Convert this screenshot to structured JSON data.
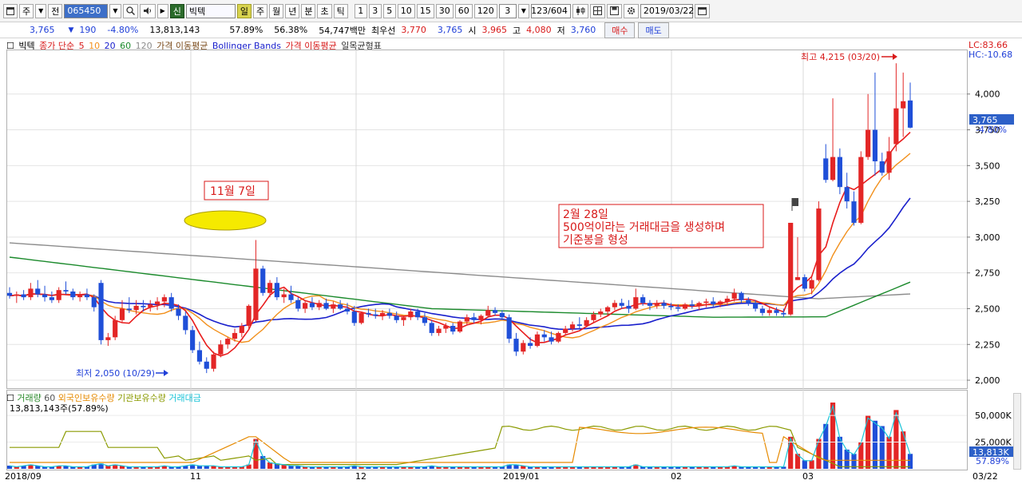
{
  "toolbar": {
    "period_prefix": "주",
    "jeon_label": "전",
    "stock_code": "065450",
    "stock_name": "빅텍",
    "credit_badge": "신",
    "periods": [
      "일",
      "주",
      "월",
      "년",
      "분",
      "초",
      "틱"
    ],
    "active_period": "일",
    "minutes": [
      "1",
      "3",
      "5",
      "10",
      "15",
      "30",
      "60",
      "120"
    ],
    "select_value": "3",
    "page_counter": "123/604",
    "date": "2019/03/22"
  },
  "quote": {
    "price": "3,765",
    "change_arrow": "▼",
    "change": "190",
    "change_pct": "-4.80%",
    "volume": "13,813,143",
    "volume_ratio": "57.89%",
    "ratio2": "56.38%",
    "amount": "54,747백만",
    "best_ask_label": "최우선",
    "best_ask": "3,770",
    "best_bid": "3,765",
    "open_label": "시",
    "open": "3,965",
    "high_label": "고",
    "high": "4,080",
    "low_label": "저",
    "low": "3,760",
    "buy_btn": "매수",
    "sell_btn": "매도"
  },
  "legend": {
    "name": "빅텍",
    "ma_label": "종가 단순",
    "ma5": "5",
    "ma10": "10",
    "ma20": "20",
    "ma60": "60",
    "ma120": "120",
    "price_ma": "가격 이동평균",
    "bollinger": "Bollinger Bands",
    "price_ma2": "가격 이동평균",
    "ichimoku": "일목균형표"
  },
  "right_info": {
    "lc": "LC:83.66",
    "hc": "HC:-10.68"
  },
  "annotations": {
    "high_note": "최고 4,215 (03/20)",
    "low_note": "최저 2,050 (10/29)",
    "nov_label": "11월 7일",
    "feb_line1": "2월 28일",
    "feb_line2": "500억이라는 거래대금을 생성하며",
    "feb_line3": "기준봉을 형성"
  },
  "price_axis": {
    "ticks": [
      "4,000",
      "3,750",
      "3,500",
      "3,250",
      "3,000",
      "2,750",
      "2,500",
      "2,250",
      "2,000"
    ],
    "current_price": "3,765",
    "current_pct": "-4.80%"
  },
  "volume_panel": {
    "legend_vol": "거래량",
    "legend_vol_ma": "60",
    "legend_foreign": "외국인보유수량",
    "legend_inst": "기관보유수량",
    "legend_amount": "거래대금",
    "summary": "13,813,143주(57.89%)",
    "ticks": [
      "50,000K",
      "25,000K"
    ],
    "current": "13,813K",
    "current_pct": "57.89%"
  },
  "x_axis": [
    "2018/09",
    "11",
    "12",
    "2019/01",
    "02",
    "03",
    "03/22"
  ],
  "colors": {
    "up": "#e32626",
    "down": "#1f4fd8",
    "ma5": "#e81c1c",
    "ma20": "#f2901c",
    "ma60": "#1a20cc",
    "ma120": "#1b8a2c",
    "ma_long": "#8c8c8c"
  },
  "chart_data": {
    "type": "candlestick",
    "ylim": [
      1950,
      4300
    ],
    "candles": [
      [
        2610,
        2650,
        2570,
        2590
      ],
      [
        2590,
        2620,
        2540,
        2600
      ],
      [
        2600,
        2630,
        2560,
        2580
      ],
      [
        2580,
        2680,
        2560,
        2640
      ],
      [
        2640,
        2700,
        2580,
        2600
      ],
      [
        2600,
        2660,
        2550,
        2580
      ],
      [
        2580,
        2620,
        2540,
        2560
      ],
      [
        2560,
        2650,
        2540,
        2630
      ],
      [
        2630,
        2690,
        2600,
        2620
      ],
      [
        2620,
        2640,
        2560,
        2580
      ],
      [
        2580,
        2620,
        2550,
        2600
      ],
      [
        2600,
        2640,
        2560,
        2580
      ],
      [
        2580,
        2600,
        2480,
        2510
      ],
      [
        2680,
        2700,
        2250,
        2280
      ],
      [
        2280,
        2330,
        2240,
        2300
      ],
      [
        2300,
        2450,
        2280,
        2420
      ],
      [
        2420,
        2560,
        2400,
        2500
      ],
      [
        2500,
        2580,
        2470,
        2490
      ],
      [
        2490,
        2560,
        2460,
        2520
      ],
      [
        2520,
        2560,
        2480,
        2510
      ],
      [
        2510,
        2560,
        2480,
        2530
      ],
      [
        2530,
        2580,
        2490,
        2550
      ],
      [
        2550,
        2600,
        2510,
        2580
      ],
      [
        2580,
        2610,
        2480,
        2500
      ],
      [
        2500,
        2530,
        2420,
        2450
      ],
      [
        2450,
        2480,
        2320,
        2350
      ],
      [
        2350,
        2380,
        2190,
        2210
      ],
      [
        2210,
        2270,
        2110,
        2130
      ],
      [
        2130,
        2160,
        2050,
        2080
      ],
      [
        2080,
        2200,
        2060,
        2180
      ],
      [
        2180,
        2280,
        2160,
        2250
      ],
      [
        2250,
        2300,
        2220,
        2290
      ],
      [
        2290,
        2360,
        2270,
        2330
      ],
      [
        2330,
        2400,
        2300,
        2380
      ],
      [
        2380,
        2530,
        2360,
        2520
      ],
      [
        2420,
        2980,
        2410,
        2780
      ],
      [
        2780,
        2800,
        2590,
        2610
      ],
      [
        2610,
        2700,
        2580,
        2680
      ],
      [
        2680,
        2720,
        2560,
        2580
      ],
      [
        2580,
        2640,
        2540,
        2600
      ],
      [
        2600,
        2660,
        2540,
        2560
      ],
      [
        2560,
        2580,
        2480,
        2500
      ],
      [
        2500,
        2560,
        2470,
        2540
      ],
      [
        2540,
        2580,
        2490,
        2510
      ],
      [
        2510,
        2560,
        2490,
        2540
      ],
      [
        2540,
        2570,
        2490,
        2500
      ],
      [
        2500,
        2550,
        2470,
        2530
      ],
      [
        2530,
        2560,
        2490,
        2500
      ],
      [
        2500,
        2540,
        2460,
        2480
      ],
      [
        2480,
        2520,
        2380,
        2400
      ],
      [
        2400,
        2480,
        2390,
        2470
      ],
      [
        2470,
        2500,
        2440,
        2460
      ],
      [
        2460,
        2500,
        2430,
        2450
      ],
      [
        2450,
        2490,
        2420,
        2470
      ],
      [
        2470,
        2500,
        2430,
        2450
      ],
      [
        2450,
        2480,
        2400,
        2420
      ],
      [
        2420,
        2450,
        2380,
        2440
      ],
      [
        2440,
        2500,
        2420,
        2480
      ],
      [
        2480,
        2500,
        2420,
        2440
      ],
      [
        2440,
        2470,
        2380,
        2400
      ],
      [
        2400,
        2420,
        2310,
        2330
      ],
      [
        2330,
        2380,
        2310,
        2360
      ],
      [
        2360,
        2400,
        2330,
        2380
      ],
      [
        2380,
        2400,
        2320,
        2340
      ],
      [
        2340,
        2420,
        2330,
        2410
      ],
      [
        2410,
        2460,
        2390,
        2440
      ],
      [
        2440,
        2470,
        2400,
        2420
      ],
      [
        2420,
        2460,
        2390,
        2450
      ],
      [
        2450,
        2520,
        2440,
        2490
      ],
      [
        2490,
        2510,
        2450,
        2470
      ],
      [
        2470,
        2490,
        2420,
        2440
      ],
      [
        2440,
        2460,
        2260,
        2290
      ],
      [
        2290,
        2330,
        2170,
        2200
      ],
      [
        2200,
        2280,
        2180,
        2260
      ],
      [
        2260,
        2300,
        2220,
        2240
      ],
      [
        2240,
        2340,
        2230,
        2320
      ],
      [
        2320,
        2350,
        2270,
        2300
      ],
      [
        2300,
        2340,
        2250,
        2270
      ],
      [
        2270,
        2340,
        2260,
        2330
      ],
      [
        2330,
        2380,
        2310,
        2360
      ],
      [
        2360,
        2410,
        2340,
        2390
      ],
      [
        2390,
        2440,
        2360,
        2380
      ],
      [
        2380,
        2440,
        2370,
        2420
      ],
      [
        2420,
        2480,
        2400,
        2460
      ],
      [
        2460,
        2500,
        2440,
        2480
      ],
      [
        2480,
        2520,
        2450,
        2510
      ],
      [
        2510,
        2560,
        2490,
        2540
      ],
      [
        2540,
        2570,
        2500,
        2520
      ],
      [
        2520,
        2560,
        2470,
        2500
      ],
      [
        2500,
        2640,
        2490,
        2580
      ],
      [
        2580,
        2600,
        2520,
        2540
      ],
      [
        2540,
        2560,
        2490,
        2520
      ],
      [
        2520,
        2560,
        2500,
        2540
      ],
      [
        2540,
        2560,
        2500,
        2520
      ],
      [
        2520,
        2540,
        2490,
        2510
      ],
      [
        2510,
        2530,
        2480,
        2500
      ],
      [
        2500,
        2540,
        2490,
        2530
      ],
      [
        2530,
        2560,
        2500,
        2520
      ],
      [
        2520,
        2550,
        2490,
        2540
      ],
      [
        2540,
        2570,
        2510,
        2550
      ],
      [
        2550,
        2580,
        2510,
        2530
      ],
      [
        2530,
        2560,
        2510,
        2550
      ],
      [
        2550,
        2590,
        2520,
        2570
      ],
      [
        2570,
        2640,
        2550,
        2610
      ],
      [
        2610,
        2620,
        2540,
        2560
      ],
      [
        2560,
        2580,
        2520,
        2540
      ],
      [
        2540,
        2560,
        2480,
        2500
      ],
      [
        2500,
        2520,
        2450,
        2470
      ],
      [
        2470,
        2510,
        2450,
        2490
      ],
      [
        2490,
        2510,
        2450,
        2470
      ],
      [
        2470,
        2500,
        2440,
        2460
      ],
      [
        2460,
        3100,
        2450,
        3100
      ],
      [
        2700,
        3000,
        2700,
        2720
      ],
      [
        2720,
        2740,
        2620,
        2640
      ],
      [
        2640,
        2720,
        2600,
        2700
      ],
      [
        2700,
        3250,
        2690,
        3200
      ],
      [
        3550,
        3650,
        3380,
        3400
      ],
      [
        3400,
        3970,
        3390,
        3560
      ],
      [
        3560,
        3620,
        3300,
        3350
      ],
      [
        3350,
        3450,
        3200,
        3250
      ],
      [
        3250,
        3320,
        3080,
        3100
      ],
      [
        3100,
        3600,
        3090,
        3560
      ],
      [
        3560,
        4000,
        3540,
        3750
      ],
      [
        3750,
        4150,
        3430,
        3530
      ],
      [
        3530,
        3590,
        3430,
        3450
      ],
      [
        3450,
        3700,
        3400,
        3600
      ],
      [
        3650,
        4215,
        3600,
        3900
      ],
      [
        3900,
        4150,
        3700,
        3950
      ],
      [
        3955,
        4080,
        3760,
        3765
      ]
    ],
    "volumes": [
      3,
      2,
      3,
      4,
      3,
      2,
      2,
      3,
      3,
      2,
      2,
      2,
      4,
      5,
      3,
      4,
      3,
      2,
      2,
      2,
      2,
      2,
      3,
      2,
      2,
      3,
      4,
      3,
      3,
      3,
      2,
      2,
      2,
      2,
      4,
      28,
      12,
      6,
      5,
      4,
      3,
      3,
      2,
      2,
      2,
      2,
      2,
      2,
      2,
      3,
      2,
      2,
      2,
      2,
      2,
      2,
      2,
      2,
      2,
      2,
      3,
      2,
      2,
      2,
      2,
      2,
      2,
      2,
      2,
      2,
      2,
      4,
      4,
      3,
      2,
      2,
      2,
      2,
      2,
      2,
      2,
      2,
      2,
      2,
      2,
      2,
      2,
      2,
      2,
      4,
      2,
      2,
      2,
      2,
      2,
      2,
      2,
      2,
      2,
      2,
      2,
      2,
      2,
      3,
      2,
      2,
      2,
      2,
      2,
      2,
      2,
      30,
      14,
      8,
      8,
      28,
      42,
      62,
      30,
      18,
      14,
      25,
      50,
      45,
      40,
      30,
      55,
      35,
      14
    ]
  }
}
